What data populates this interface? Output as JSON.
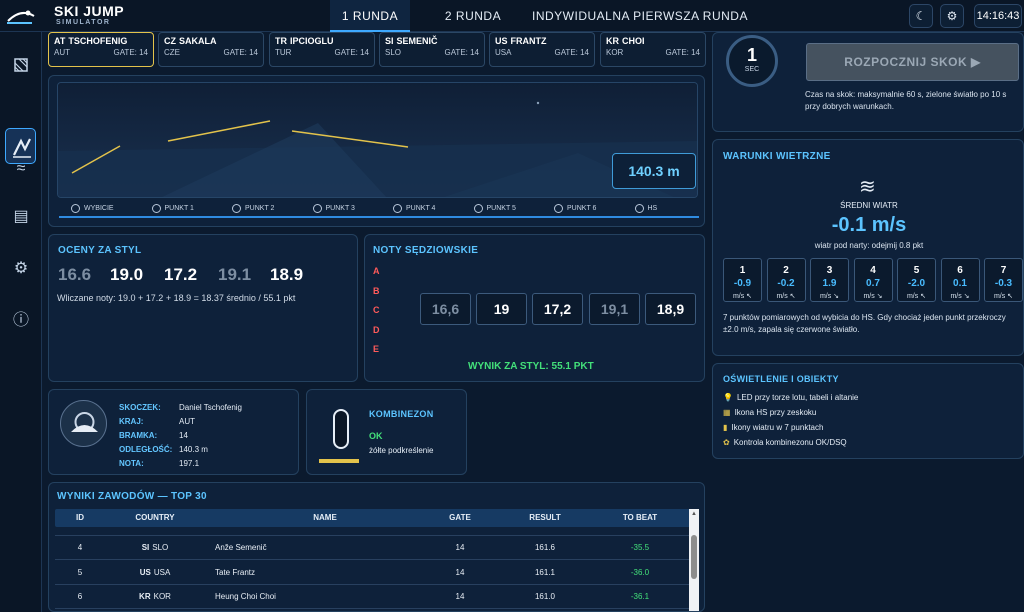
{
  "app": {
    "title": "SKI JUMP",
    "subtitle": "SIMULATOR"
  },
  "tabs": [
    "1 RUNDA",
    "2 RUNDA",
    "INDYWIDUALNA PIERWSZA RUNDA"
  ],
  "header": {
    "theme_icon": "☾",
    "settings_icon": "⚙",
    "clock": "14:16:43"
  },
  "jumpers": [
    {
      "code": "AT",
      "name": "TSCHOFENIG",
      "country": "AUT",
      "gate": "GATE: 14"
    },
    {
      "code": "CZ",
      "name": "SAKALA",
      "country": "CZE",
      "gate": "GATE: 14"
    },
    {
      "code": "TR",
      "name": "IPCIOGLU",
      "country": "TUR",
      "gate": "GATE: 14"
    },
    {
      "code": "SI",
      "name": "SEMENIČ",
      "country": "SLO",
      "gate": "GATE: 14"
    },
    {
      "code": "US",
      "name": "FRANTZ",
      "country": "USA",
      "gate": "GATE: 14"
    },
    {
      "code": "KR",
      "name": "CHOI",
      "country": "KOR",
      "gate": "GATE: 14"
    }
  ],
  "hill": {
    "distance": "140.3 m",
    "points": [
      "WYBICIE",
      "PUNKT 1",
      "PUNKT 2",
      "PUNKT 3",
      "PUNKT 4",
      "PUNKT 5",
      "PUNKT 6",
      "HS"
    ]
  },
  "style": {
    "title": "OCENY ZA STYL",
    "scores": [
      "16.6",
      "19.0",
      "17.2",
      "19.1",
      "18.9"
    ],
    "calc": "Wliczane noty: 19.0 + 17.2 + 18.9 = 18.37 średnio / 55.1 pkt"
  },
  "judges": {
    "title": "NOTY SĘDZIOWSKIE",
    "letters": [
      "A",
      "B",
      "C",
      "D",
      "E"
    ],
    "notes": [
      "16,6",
      "19",
      "17,2",
      "19,1",
      "18,9"
    ],
    "result": "WYNIK ZA STYL: 55.1 PKT"
  },
  "skoczek": {
    "labels": [
      "SKOCZEK:",
      "KRAJ:",
      "BRAMKA:",
      "ODLEGŁOŚĆ:",
      "NOTA:"
    ],
    "values": [
      "Daniel Tschofenig",
      "AUT",
      "14",
      "140.3 m",
      "197.1"
    ]
  },
  "kombinezon": {
    "title": "KOMBINEZON",
    "status": "OK",
    "note": "żółte podkreślenie"
  },
  "results": {
    "title": "WYNIKI ZAWODÓW — TOP 30",
    "headers": [
      "ID",
      "COUNTRY",
      "NAME",
      "GATE",
      "RESULT",
      "TO BEAT"
    ],
    "rows": [
      {
        "id": "4",
        "code": "SI",
        "country": "SLO",
        "name": "Anže Semenič",
        "gate": "14",
        "result": "161.6",
        "to_beat": "-35.5"
      },
      {
        "id": "5",
        "code": "US",
        "country": "USA",
        "name": "Tate Frantz",
        "gate": "14",
        "result": "161.1",
        "to_beat": "-36.0"
      },
      {
        "id": "6",
        "code": "KR",
        "country": "KOR",
        "name": "Heung Choi Choi",
        "gate": "14",
        "result": "161.0",
        "to_beat": "-36.1"
      }
    ]
  },
  "start": {
    "timer_value": "1",
    "timer_unit": "SEC",
    "button": "ROZPOCZNIJ SKOK ▶",
    "info": "Czas na skok: maksymalnie 60 s, zielone światło po 10 s przy dobrych warunkach."
  },
  "wind": {
    "title": "WARUNKI WIETRZNE",
    "avg_label": "ŚREDNI WIATR",
    "avg_value": "-0.1 m/s",
    "sub": "wiatr pod narty: odejmij 0.8 pkt",
    "cells": [
      {
        "n": "1",
        "v": "-0.9",
        "u": "m/s ↖"
      },
      {
        "n": "2",
        "v": "-0.2",
        "u": "m/s ↖"
      },
      {
        "n": "3",
        "v": "1.9",
        "u": "m/s ↘"
      },
      {
        "n": "4",
        "v": "0.7",
        "u": "m/s ↘"
      },
      {
        "n": "5",
        "v": "-2.0",
        "u": "m/s ↖"
      },
      {
        "n": "6",
        "v": "0.1",
        "u": "m/s ↘"
      },
      {
        "n": "7",
        "v": "-0.3",
        "u": "m/s ↖"
      }
    ],
    "info": "7 punktów pomiarowych od wybicia do HS. Gdy chociaż jeden punkt przekroczy ±2.0 m/s, zapala się czerwone światło."
  },
  "lighting": {
    "title": "OŚWIETLENIE I OBIEKTY",
    "items": [
      {
        "icon": "💡",
        "text": "LED przy torze lotu, tabeli i altanie"
      },
      {
        "icon": "▦",
        "text": "Ikona HS przy zeskoku"
      },
      {
        "icon": "▮",
        "text": "Ikony wiatru w 7 punktach"
      },
      {
        "icon": "✿",
        "text": "Kontrola kombinezonu OK/DSQ"
      }
    ]
  },
  "colors": {
    "accent": "#5cc4ff",
    "yellow": "#e3c34b",
    "green": "#43e07a",
    "red": "#ff5a5a"
  }
}
